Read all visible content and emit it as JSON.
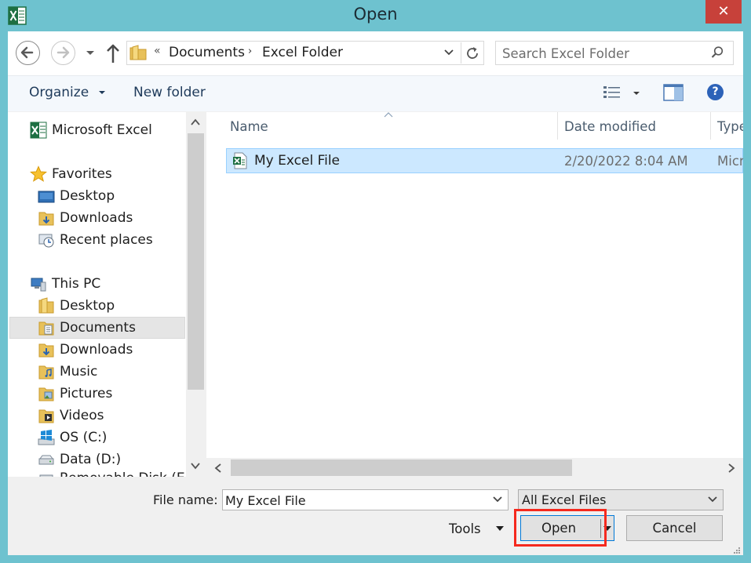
{
  "window": {
    "title": "Open",
    "close_glyph": "✕"
  },
  "address": {
    "crumbs": [
      "Documents",
      "Excel Folder"
    ],
    "overflow_glyph": "«",
    "separator_glyph": "›"
  },
  "search": {
    "placeholder": "Search Excel Folder"
  },
  "toolbar": {
    "organize_label": "Organize",
    "new_folder_label": "New folder",
    "help_glyph": "?"
  },
  "nav": {
    "items": [
      {
        "label": "Microsoft Excel",
        "icon": "excel-icon"
      },
      {
        "label": "Favorites",
        "icon": "star-icon"
      },
      {
        "label": "Desktop",
        "icon": "desktop-icon"
      },
      {
        "label": "Downloads",
        "icon": "downloads-folder-icon"
      },
      {
        "label": "Recent places",
        "icon": "recent-places-icon"
      },
      {
        "label": "This PC",
        "icon": "computer-icon"
      },
      {
        "label": "Desktop",
        "icon": "folder-icon"
      },
      {
        "label": "Documents",
        "icon": "documents-folder-icon",
        "selected": true
      },
      {
        "label": "Downloads",
        "icon": "downloads-folder-icon"
      },
      {
        "label": "Music",
        "icon": "music-folder-icon"
      },
      {
        "label": "Pictures",
        "icon": "pictures-folder-icon"
      },
      {
        "label": "Videos",
        "icon": "videos-folder-icon"
      },
      {
        "label": "OS (C:)",
        "icon": "windows-drive-icon"
      },
      {
        "label": "Data (D:)",
        "icon": "drive-icon"
      },
      {
        "label": "Removable Disk (E",
        "icon": "removable-drive-icon"
      }
    ]
  },
  "file_list": {
    "columns": [
      "Name",
      "Date modified",
      "Type"
    ],
    "rows": [
      {
        "name": "My Excel File",
        "date_modified": "2/20/2022 8:04 AM",
        "type": "Microsoft Excel Worksheet"
      }
    ]
  },
  "footer": {
    "file_name_label": "File name:",
    "file_name_value": "My Excel File",
    "filter_value": "All Excel Files",
    "tools_label": "Tools",
    "open_label": "Open",
    "cancel_label": "Cancel"
  },
  "colors": {
    "accent": "#0078d7",
    "highlight": "#f5291e",
    "selection": "#cce8ff",
    "window_frame": "#6ec2cf"
  }
}
